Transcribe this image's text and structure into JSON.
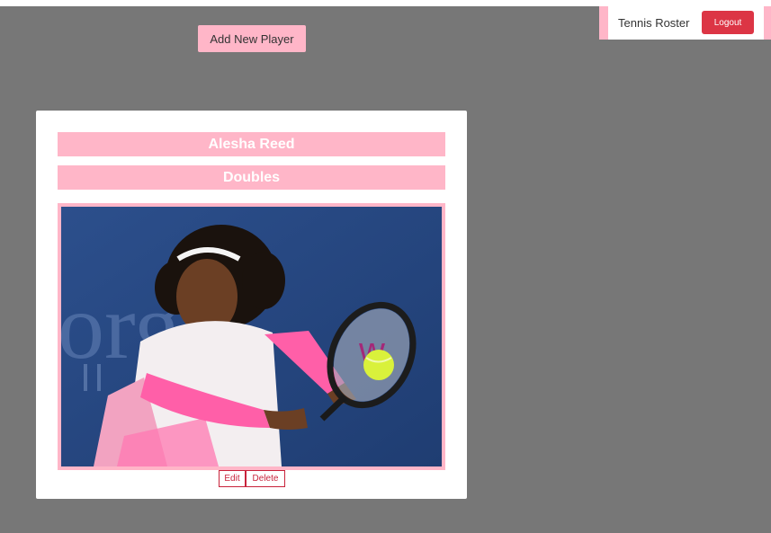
{
  "navbar": {
    "brand": "Tennis Roster",
    "logout_label": "Logout"
  },
  "toolbar": {
    "add_player_label": "Add New Player"
  },
  "player_card": {
    "name": "Alesha Reed",
    "team_type": "Doubles",
    "photo_alt": "player-photo",
    "edit_label": "Edit",
    "delete_label": "Delete"
  },
  "colors": {
    "background": "#777777",
    "accent_pink": "#ffb6c8",
    "logout_red": "#dc3545",
    "action_red": "#c8233b"
  }
}
